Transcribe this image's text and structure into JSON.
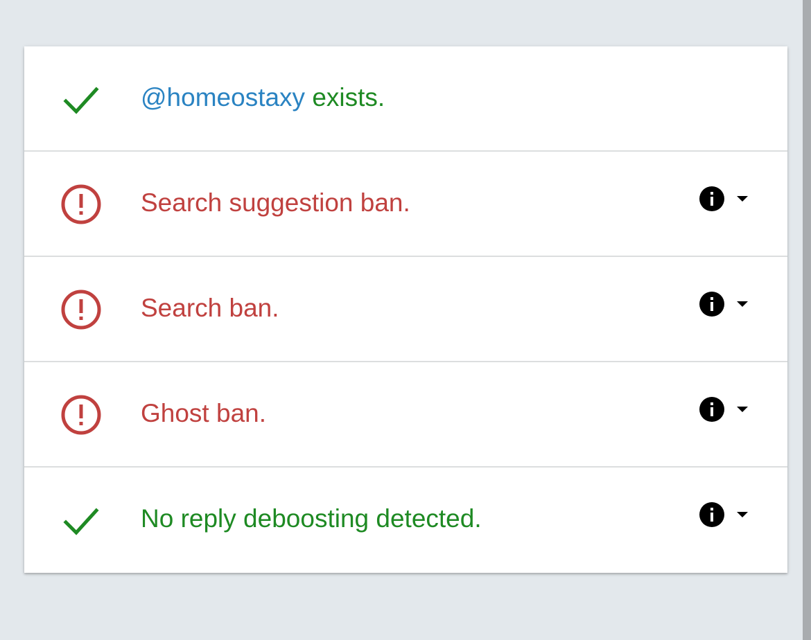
{
  "colors": {
    "ok": "#1e8a23",
    "ban": "#c0413f",
    "handle": "#2a83c2",
    "icon_dark": "#000000",
    "background": "#e3e8ec",
    "card": "#ffffff"
  },
  "results": [
    {
      "status": "ok",
      "icon": "checkmark-icon",
      "handle": "@homeostaxy",
      "text": " exists.",
      "has_actions": false
    },
    {
      "status": "ban",
      "icon": "alert-circle-icon",
      "text": "Search suggestion ban.",
      "has_actions": true
    },
    {
      "status": "ban",
      "icon": "alert-circle-icon",
      "text": "Search ban.",
      "has_actions": true
    },
    {
      "status": "ban",
      "icon": "alert-circle-icon",
      "text": "Ghost ban.",
      "has_actions": true
    },
    {
      "status": "ok",
      "icon": "checkmark-icon",
      "text": "No reply deboosting detected.",
      "has_actions": true
    }
  ],
  "actions": {
    "info_icon": "info-icon",
    "expand_icon": "caret-down-icon"
  }
}
